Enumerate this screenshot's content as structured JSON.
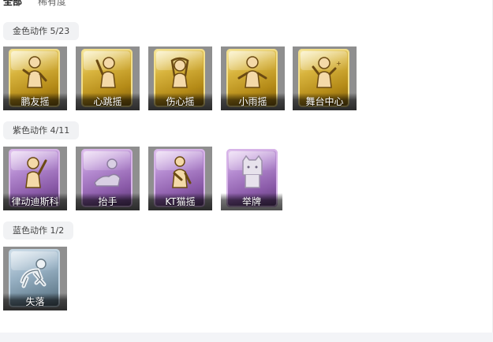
{
  "tabs": [
    {
      "label": "全部",
      "active": true
    },
    {
      "label": "稀有度",
      "active": false
    }
  ],
  "sections": {
    "gold": {
      "label": "金色动作 5/23",
      "color": "#c9a22a",
      "items": [
        {
          "name": "鹏友摇",
          "icon": "figure-dance-icon"
        },
        {
          "name": "心跳摇",
          "icon": "figure-wave-icon"
        },
        {
          "name": "伤心摇",
          "icon": "figure-heart-icon"
        },
        {
          "name": "小雨摇",
          "icon": "figure-arms-icon"
        },
        {
          "name": "舞台中心",
          "icon": "figure-stage-icon"
        }
      ]
    },
    "purple": {
      "label": "紫色动作 4/11",
      "color": "#9b6bbd",
      "items": [
        {
          "name": "律动迪斯科",
          "icon": "figure-disco-icon"
        },
        {
          "name": "抬手",
          "icon": "figure-raise-hand-icon"
        },
        {
          "name": "KT猫摇",
          "icon": "figure-cat-icon"
        },
        {
          "name": "举牌",
          "icon": "figure-sign-icon"
        }
      ]
    },
    "blue": {
      "label": "蓝色动作 1/2",
      "color": "#7f98aa",
      "items": [
        {
          "name": "失落",
          "icon": "figure-crawl-icon"
        }
      ]
    }
  }
}
